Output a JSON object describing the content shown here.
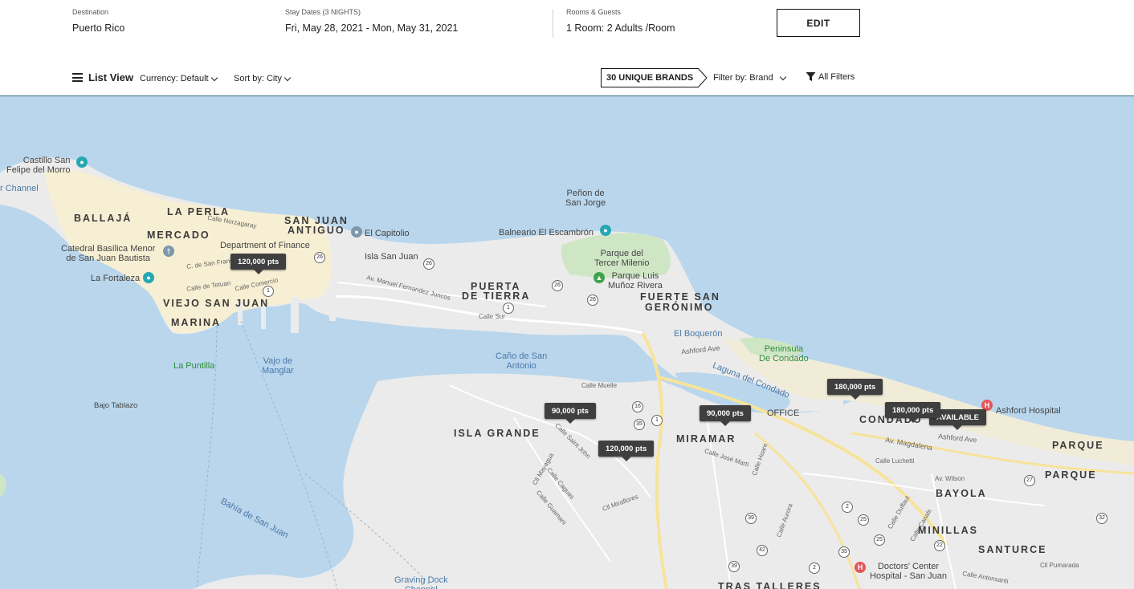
{
  "search": {
    "destination_label": "Destination",
    "destination_value": "Puerto Rico",
    "dates_label": "Stay Dates (3 NIGHTS)",
    "dates_value": "Fri, May 28, 2021 - Mon, May 31, 2021",
    "guests_label": "Rooms & Guests",
    "guests_value": "1 Room: 2 Adults /Room",
    "edit_label": "EDIT"
  },
  "toolbar": {
    "list_view_label": "List View",
    "currency_label": "Currency: Default",
    "sort_label": "Sort by: City",
    "brands_label": "30 UNIQUE BRANDS",
    "filter_brand_label": "Filter by: Brand",
    "all_filters_label": "All Filters",
    "icons": [
      "list-icon",
      "chevron-down-icon",
      "funnel-icon"
    ]
  },
  "map": {
    "water_color": "#b9d6ec",
    "land_color": "#ebebeb",
    "old_town_color": "#f7efd3",
    "park_color": "#cfe6c5",
    "places": {
      "ballaja": "BALLAJÁ",
      "la_perla": "LA PERLA",
      "mercado": "MERCADO",
      "san_juan_antiguo_1": "SAN JUAN",
      "san_juan_antiguo_2": "ANTIGUO",
      "viejo_san_juan": "VIEJO SAN JUAN",
      "marina": "MARINA",
      "puerta_de_tierra_1": "PUERTA",
      "puerta_de_tierra_2": "DE TIERRA",
      "fuerte_1": "FUERTE SAN",
      "fuerte_2": "GERÓNIMO",
      "isla_grande": "ISLA GRANDE",
      "miramar": "MIRAMAR",
      "condado": "CONDADO",
      "parque_1": "PARQUE",
      "parque_2": "PARQUE",
      "bayola": "BAYOLA",
      "minillas": "MINILLAS",
      "santurce": "SANTURCE",
      "tras_talleres": "TRAS TALLERES"
    },
    "labels": {
      "castillo": "Castillo San\nFelipe del Morro",
      "channel": "r Channel",
      "calle_norzagaray": "Calle Norzagaray",
      "dept_finance": "Department of Finance",
      "el_capitolio": "El Capitolio",
      "isla_san_juan": "Isla San Juan",
      "catedral": "Catedral Basílica Menor\nde San Juan Bautista",
      "la_fortaleza": "La Fortaleza",
      "c_san_francisco": "C. de San Francisco",
      "calle_tetuan": "Calle de Tetuan",
      "calle_comercio": "Calle Comercio",
      "av_manuel": "Av. Manuel Fernandez Juncos",
      "calle_sur": "Calle Sur",
      "penon": "Peñon de\nSan Jorge",
      "balneario": "Balneario El Escambrón",
      "parque_tercer": "Parque del\nTercer Milenio",
      "parque_luis": "Parque Luis\nMuñoz Rivera",
      "el_boqueron": "El Boquerón",
      "ashford_ave": "Ashford Ave",
      "peninsula": "Peninsula\nDe Condado",
      "laguna": "Laguna del Condado",
      "office": "OFFICE",
      "ashford_hospital": "Ashford Hospital",
      "ashford_ave_2": "Ashford Ave",
      "av_magdalena": "Av. Magdalena",
      "calle_luchetti": "Calle Luchetti",
      "av_wilson": "Av. Wilson",
      "calle_muelle": "Calle Muelle",
      "cano": "Caño de San\nAntonio",
      "vajo": "Vajo de\nManglar",
      "la_puntilla": "La Puntilla",
      "bajo_tablazo": "Bajo Tablazo",
      "bahia": "Bahía de San Juan",
      "graving": "Graving Dock\nChannel",
      "doctors": "Doctors' Center\nHospital - San Juan",
      "calle_jose_marti": "Calle José Martí",
      "calle_hoare": "Calle Hoare",
      "calle_aurora": "Calle Aurora",
      "calle_duffaut": "Calle Duffaut",
      "calle_canals": "Calle Canals",
      "cll_miraflores": "Cll Miraflores",
      "calle_saint_john": "Calle Saint John",
      "cll_mayagua": "Cll Mayagua",
      "calle_caguas": "Calle Caguas",
      "calle_guamani": "Calle Guamani",
      "cll_pumarada": "Cll Pumarada",
      "calle_antonsanti": "Calle Antonsanti"
    },
    "shields": [
      "26",
      "26",
      "1",
      "26",
      "26",
      "1",
      "16",
      "35",
      "1",
      "25",
      "2",
      "25",
      "39",
      "42",
      "2",
      "35",
      "22",
      "27",
      "39",
      "32"
    ],
    "pins": [
      {
        "label": "120,000 pts"
      },
      {
        "label": "90,000 pts"
      },
      {
        "label": "120,000 pts"
      },
      {
        "label": "90,000 pts"
      },
      {
        "label": "180,000 pts"
      },
      {
        "label": "180,000 pts"
      },
      {
        "label": "AVAILABLE"
      }
    ]
  }
}
